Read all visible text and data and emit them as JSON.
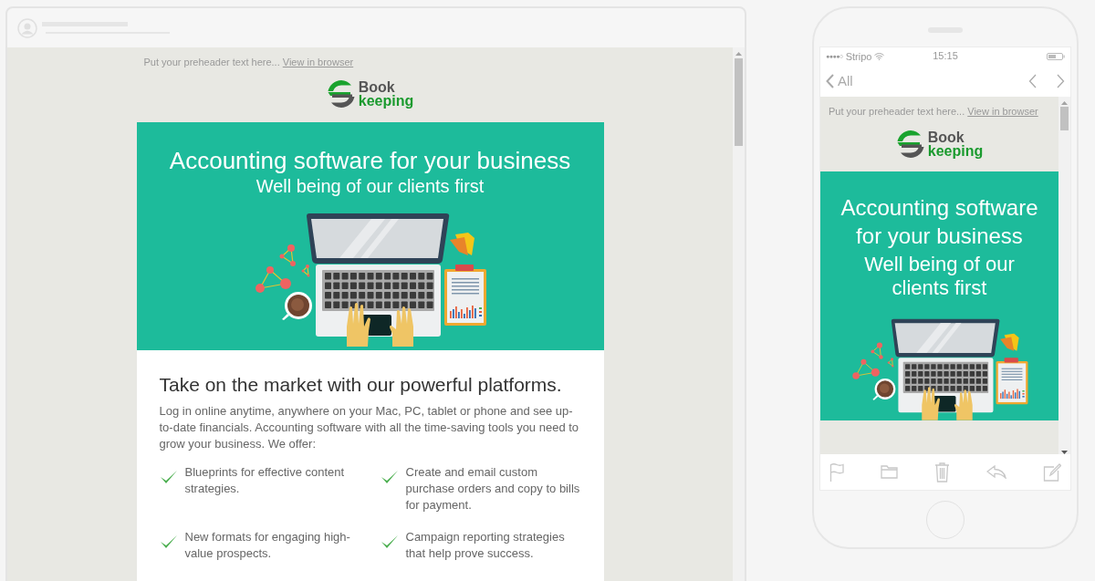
{
  "desktop_preview": {
    "preheader": {
      "text": "Put your preheader text here...",
      "link": "View in browser"
    },
    "logo": {
      "line_1": "Book",
      "line_2": "keeping"
    },
    "hero": {
      "title": "Accounting software for your business",
      "subtitle": "Well being of our clients first"
    },
    "content": {
      "heading": "Take on the market with our powerful platforms.",
      "paragraph": "Log in online anytime, anywhere on your Mac, PC, tablet or phone and see up-to-date financials. Accounting software with all the time-saving tools you need to grow your business. We offer:",
      "features": [
        {
          "text": "Blueprints for effective content strategies."
        },
        {
          "text": "Create and email custom purchase orders and copy to bills for payment."
        },
        {
          "text": "New formats for engaging high-value prospects."
        },
        {
          "text": "Campaign reporting strategies that help prove success."
        }
      ]
    }
  },
  "mobile_preview": {
    "status_bar": {
      "signal": "●●●●○",
      "carrier": "Stripo",
      "time": "15:15"
    },
    "nav": {
      "back_label": "All"
    },
    "preheader": {
      "text": "Put your preheader text here...",
      "link": "View in browser"
    },
    "logo": {
      "line_1": "Book",
      "line_2": "keeping"
    },
    "hero": {
      "title": "Accounting software for your business",
      "subtitle": "Well being of our clients first"
    }
  }
}
